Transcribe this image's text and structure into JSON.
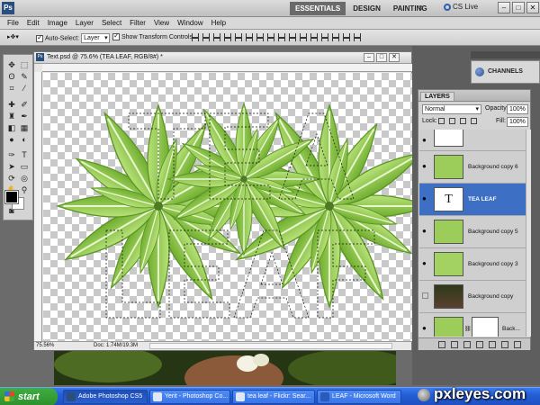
{
  "app": {
    "logo": "Ps"
  },
  "menu": {
    "items": [
      "File",
      "Edit",
      "Image",
      "Layer",
      "Select",
      "Filter",
      "View",
      "Window",
      "Help"
    ],
    "zoom": "75.6"
  },
  "workspaces": {
    "items": [
      "ESSENTIALS",
      "DESIGN",
      "PAINTING"
    ],
    "more": "»",
    "cslive": "CS Live"
  },
  "options": {
    "auto_select_label": "Auto-Select:",
    "auto_select_value": "Layer",
    "transform_label": "Show Transform Controls"
  },
  "document": {
    "title": "Text.psd @ 75.6% (TEA LEAF, RGB/8#) *",
    "zoom_status": "75.56%",
    "doc_info": "Doc: 1.74M/19.3M"
  },
  "panels": {
    "channels": "CHANNELS"
  },
  "layers": {
    "tab": "LAYERS",
    "blend_mode": "Normal",
    "opacity_label": "Opacity:",
    "opacity_value": "100%",
    "lock_label": "Lock:",
    "fill_label": "Fill:",
    "fill_value": "100%",
    "thumb_text": "T",
    "rows": [
      {
        "name": "",
        "kind": "white"
      },
      {
        "name": "Background copy 6",
        "kind": "leaf"
      },
      {
        "name": "TEA LEAF",
        "kind": "text"
      },
      {
        "name": "Background copy 5",
        "kind": "leaf"
      },
      {
        "name": "Background copy 3",
        "kind": "leaf"
      },
      {
        "name": "Background copy",
        "kind": "photo"
      },
      {
        "name": "Back...",
        "kind": "leafmask"
      }
    ]
  },
  "taskbar": {
    "start": "start",
    "tasks": [
      "Adobe Photoshop CS5",
      "Yerit - Photoshop Co...",
      "tea leaf - Flickr: Sear...",
      "LEAF - Microsoft Word"
    ]
  },
  "watermark": "pxleyes.com",
  "colors": {
    "accent": "#3d6fc4",
    "leaf": "#8cc24a",
    "taskbar": "#245ed6"
  }
}
